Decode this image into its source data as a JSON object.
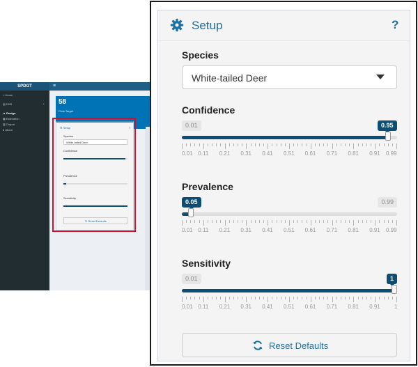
{
  "thumbnail": {
    "brand": "SPDGT",
    "menu_icon": "hamburger-icon",
    "sidebar_items": [
      "Home",
      "DNS",
      "Design",
      "Estimation",
      "Output",
      "About"
    ],
    "active_item": "Design",
    "value_box": {
      "value": "58",
      "subtitle": "Plots Target"
    },
    "mini_box_title": "Setup",
    "mini_species": "White-tailed Deer",
    "mini_reset": "Reset Defaults"
  },
  "setup": {
    "title": "Setup",
    "title_icon": "gear-icon",
    "help": "?",
    "species": {
      "label": "Species",
      "value": "White-tailed Deer",
      "dropdown_icon": "caret-down-icon"
    },
    "sliders": [
      {
        "id": "confidence",
        "label": "Confidence",
        "min_label": "0.01",
        "max_label": "0.99",
        "value_label": "0.95",
        "value": 0.95,
        "min": 0.01,
        "max": 0.99,
        "show_min": true,
        "show_max": false
      },
      {
        "id": "prevalence",
        "label": "Prevalence",
        "min_label": "0.01",
        "max_label": "0.99",
        "value_label": "0.05",
        "value": 0.05,
        "min": 0.01,
        "max": 0.99,
        "show_min": false,
        "show_max": true
      },
      {
        "id": "sensitivity",
        "label": "Sensitivity",
        "min_label": "0.01",
        "max_label": "1",
        "value_label": "1",
        "value": 1,
        "min": 0.01,
        "max": 1,
        "show_min": true,
        "show_max": false
      }
    ],
    "grid_labels_a": [
      "0.01",
      "0.11",
      "0.21",
      "0.31",
      "0.41",
      "0.51",
      "0.61",
      "0.71",
      "0.81",
      "0.91",
      "0.99"
    ],
    "grid_labels_b": [
      "0.01",
      "0.11",
      "0.21",
      "0.31",
      "0.41",
      "0.51",
      "0.61",
      "0.71",
      "0.81",
      "0.91",
      "1"
    ],
    "reset": {
      "label": "Reset Defaults",
      "icon": "refresh-icon"
    }
  },
  "colors": {
    "accent": "#1d6fa5",
    "slider_fill": "#0b4d75",
    "highlight": "#d0112b",
    "sidebar": "#222d32"
  }
}
